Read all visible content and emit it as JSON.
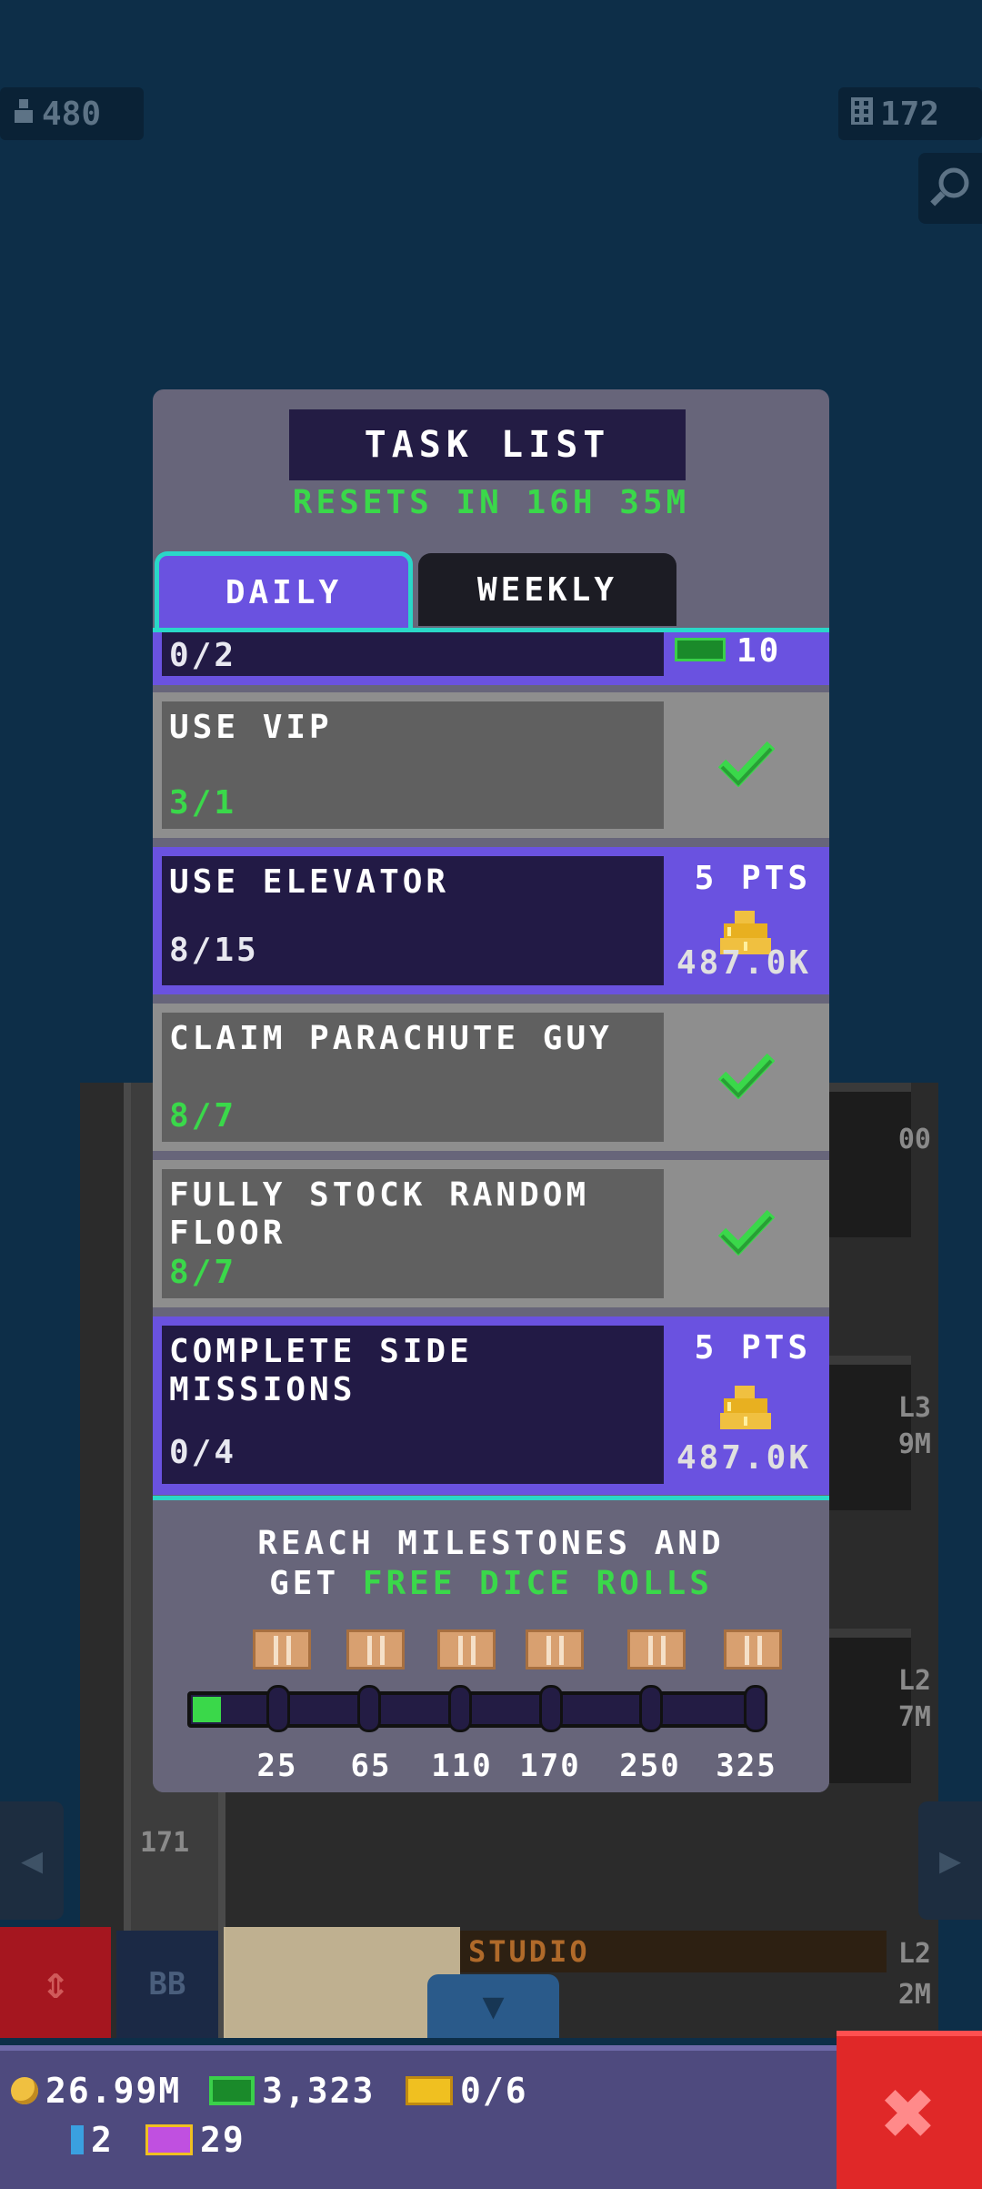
{
  "hud": {
    "population": "480",
    "floors": "172",
    "population_icon": "person-icon",
    "floors_icon": "building-icon",
    "zoom_icon": "magnifier-icon"
  },
  "task_list": {
    "title": "TASK LIST",
    "resets": "RESETS IN 16H 35M",
    "tabs": [
      {
        "label": "DAILY",
        "selected": true
      },
      {
        "label": "WEEKLY",
        "selected": false
      }
    ],
    "partial_row": {
      "progress": "0/2",
      "reward": "10"
    },
    "tasks": [
      {
        "name": "USE VIP",
        "progress": "3/1",
        "done": true
      },
      {
        "name": "USE ELEVATOR",
        "progress": "8/15",
        "done": false,
        "points": "5 PTS",
        "coins": "487.0K"
      },
      {
        "name": "CLAIM PARACHUTE GUY",
        "progress": "8/7",
        "done": true
      },
      {
        "name": "FULLY STOCK RANDOM FLOOR",
        "progress": "8/7",
        "done": true
      },
      {
        "name": "COMPLETE SIDE MISSIONS",
        "progress": "0/4",
        "done": false,
        "points": "5 PTS",
        "coins": "487.0K"
      }
    ],
    "milestones": {
      "line1": "REACH MILESTONES AND",
      "line2_prefix": "GET ",
      "line2_highlight": "FREE DICE ROLLS",
      "labels": [
        "25",
        "65",
        "110",
        "170",
        "250",
        "325"
      ],
      "progress_fraction": 0.05
    }
  },
  "building": {
    "studio_label": "STUDIO",
    "floor_171": "171",
    "level_labels": [
      "L3",
      "L2",
      "L2"
    ],
    "value_labels": [
      "9M",
      "7M",
      "2M"
    ],
    "top_label": "00"
  },
  "toolbar": {
    "bb_label": "BB"
  },
  "status": {
    "coins": "26.99M",
    "bux": "3,323",
    "tickets": "0/6",
    "bitizens": "2",
    "tv": "29"
  },
  "colors": {
    "accent_purple": "#6a52e0",
    "teal": "#2ad7c8",
    "green": "#3ad84a",
    "close_red": "#e02828"
  }
}
